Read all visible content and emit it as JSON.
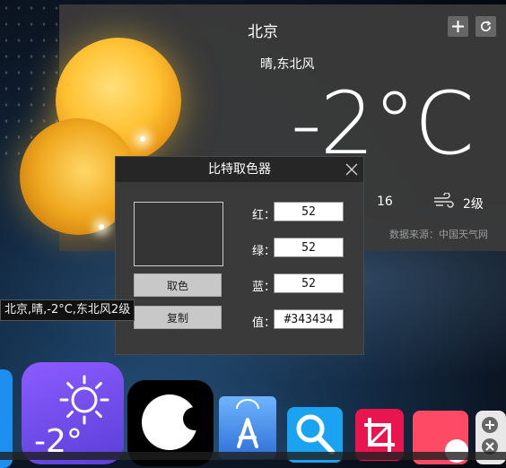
{
  "weather": {
    "city": "北京",
    "condition": "晴,东北风",
    "temperature": "-2°C",
    "humidity": "16",
    "wind_level": "2级",
    "source": "数据来源：中国天气网",
    "add_icon": "plus-icon",
    "refresh_icon": "refresh-icon"
  },
  "picker": {
    "title": "比特取色器",
    "pick_label": "取色",
    "copy_label": "复制",
    "red_label": "红：",
    "red_value": "52",
    "green_label": "绿：",
    "green_value": "52",
    "blue_label": "蓝：",
    "blue_value": "52",
    "value_label": "值：",
    "hex_value": "#343434",
    "swatch_color": "#343434"
  },
  "tooltip": {
    "text": "北京,晴,-2°C,东北风2级"
  },
  "dock": {
    "weather_temp": "-2°"
  }
}
